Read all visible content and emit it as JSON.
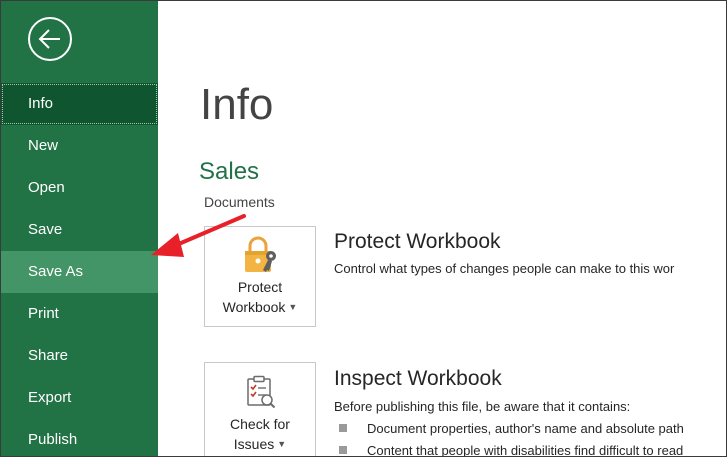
{
  "nav": {
    "back_icon": "back-arrow-icon",
    "items": [
      {
        "label": "Info"
      },
      {
        "label": "New"
      },
      {
        "label": "Open"
      },
      {
        "label": "Save"
      },
      {
        "label": "Save As"
      },
      {
        "label": "Print"
      },
      {
        "label": "Share"
      },
      {
        "label": "Export"
      },
      {
        "label": "Publish"
      }
    ]
  },
  "main": {
    "title": "Info",
    "file_name": "Sales",
    "file_location": "Documents",
    "protect": {
      "button_line1": "Protect",
      "button_line2": "Workbook",
      "title": "Protect Workbook",
      "description": "Control what types of changes people can make to this wor"
    },
    "inspect": {
      "button_line1": "Check for",
      "button_line2": "Issues",
      "title": "Inspect Workbook",
      "description": "Before publishing this file, be aware that it contains:",
      "bullets": [
        "Document properties, author's name and absolute path",
        "Content that people with disabilities find difficult to read"
      ]
    }
  },
  "colors": {
    "sidebar": "#217346",
    "sidebar_selected": "#0e5530",
    "sidebar_hover": "#439467",
    "accent_green": "#217346",
    "annotation_arrow": "#e8202a"
  }
}
